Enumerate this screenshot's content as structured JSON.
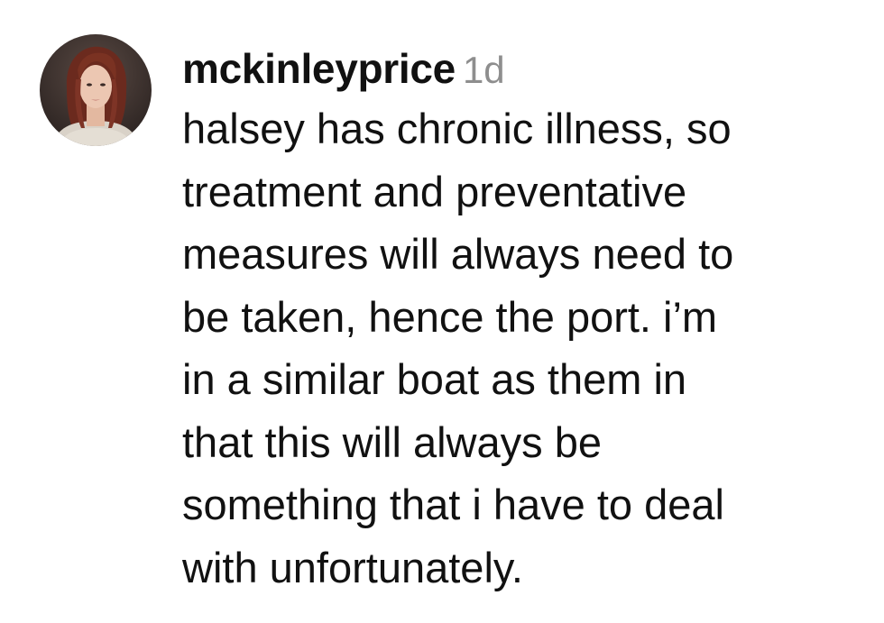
{
  "comment": {
    "username": "mckinleyprice",
    "timestamp": "1d",
    "text_lines": [
      "halsey has chronic illness, so",
      "treatment and preventative",
      "measures will always need to",
      "be taken, hence the port. i’m",
      "in a similar boat as them in",
      "that this will always be",
      "something that i have to deal",
      "with unfortunately."
    ]
  },
  "colors": {
    "text": "#111111",
    "timestamp": "#8e8e8e",
    "background": "#ffffff"
  }
}
